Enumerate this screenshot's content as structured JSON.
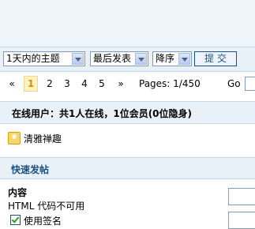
{
  "filters": {
    "time_range": "1天内的主题",
    "sort_by": "最后发表",
    "order": "降序",
    "submit_label": "提交"
  },
  "pager": {
    "first": "«",
    "pages": [
      "1",
      "2",
      "3",
      "4",
      "5"
    ],
    "next": "»",
    "info": "Pages: 1/450",
    "go_label": "Go"
  },
  "online": {
    "title": "在线用户：共1人在线，1位会员(0位隐身)",
    "users": [
      "清雅禅趣"
    ]
  },
  "quick_post": {
    "title": "快速发帖",
    "content_label": "内容",
    "html_note": "HTML 代码不可用",
    "signature_label": "使用签名"
  },
  "colors": {
    "header_bg": "#e8f0f8",
    "header_text": "#1c5180",
    "current_page": "#e08a00"
  }
}
